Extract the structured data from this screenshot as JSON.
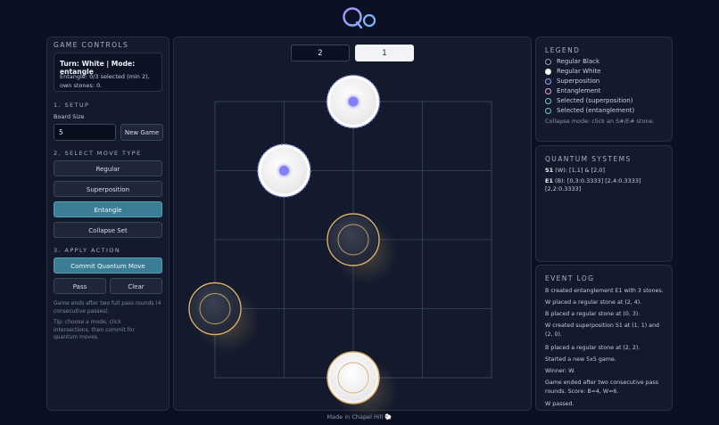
{
  "logo": {
    "text": "Qo"
  },
  "controls": {
    "title": "GAME CONTROLS",
    "turn_line": "Turn: White | Mode: entangle",
    "entangle_line": "Entangle: 0/3 selected (min 2),",
    "stones_line": "own stones: 0.",
    "setup_title": "1. SETUP",
    "board_size_label": "Board Size",
    "board_size_value": "5",
    "new_game_label": "New Game",
    "move_type_title": "2. SELECT MOVE TYPE",
    "move_types": [
      "Regular",
      "Superposition",
      "Entangle",
      "Collapse Set"
    ],
    "active_move_type": "Entangle",
    "apply_title": "3. APPLY ACTION",
    "commit_label": "Commit Quantum Move",
    "pass_label": "Pass",
    "clear_label": "Clear",
    "note_lines": [
      "Game ends after two full pass rounds (4",
      "consecutive passes)."
    ],
    "tip_lines": [
      "Tip: choose a mode, click",
      "intersections, then commit for",
      "quantum moves."
    ]
  },
  "scores": {
    "black": "2",
    "white": "1"
  },
  "board": {
    "size": 5,
    "stones": [
      {
        "kind": "superposition",
        "col": 2,
        "row": 0
      },
      {
        "kind": "superposition",
        "col": 1,
        "row": 1
      },
      {
        "kind": "entangled-black",
        "col": 2,
        "row": 2
      },
      {
        "kind": "entangled-black",
        "col": 0,
        "row": 3
      },
      {
        "kind": "entangled-white",
        "col": 2,
        "row": 4
      }
    ]
  },
  "legend": {
    "title": "LEGEND",
    "items": [
      {
        "label": "Regular Black",
        "color": "#0b1122",
        "border": "#9aa3b8"
      },
      {
        "label": "Regular White",
        "color": "#f2f2f2",
        "border": "#f2f2f2"
      },
      {
        "label": "Superposition",
        "color": "#131a2c",
        "border": "#8fa5ff"
      },
      {
        "label": "Entanglement",
        "color": "#131a2c",
        "border": "#e7a3d6"
      },
      {
        "label": "Selected (superposition)",
        "color": "#131a2c",
        "border": "#6fc9bf"
      },
      {
        "label": "Selected (entanglement)",
        "color": "#131a2c",
        "border": "#6fc9bf"
      }
    ],
    "note": "Collapse mode: click an S#/E# stone."
  },
  "systems": {
    "title": "QUANTUM SYSTEMS",
    "s1_id": "S1",
    "s1_text": " (W): [1,1] & [2,0]",
    "e1_id": "E1",
    "e1_text": " (B): [0,3:0.3333] [2,4:0.3333]",
    "e1_text2": "[2,2:0.3333]"
  },
  "log": {
    "title": "EVENT LOG",
    "entries": [
      [
        "B created entanglement E1 with 3 stones."
      ],
      [
        "W placed a regular stone at (2, 4)."
      ],
      [
        "B placed a regular stone at (0, 3)."
      ],
      [
        "W created superposition S1 at (1, 1) and",
        "(2, 0)."
      ],
      [
        "B placed a regular stone at (2, 2)."
      ],
      [
        "Started a new 5x5 game."
      ],
      [
        "Winner: W."
      ],
      [
        "Game ended after two consecutive pass",
        "rounds. Score: B=4, W=6."
      ],
      [
        "W passed."
      ]
    ]
  },
  "footer": {
    "text": "Made in Chapel Hill 🐑"
  }
}
